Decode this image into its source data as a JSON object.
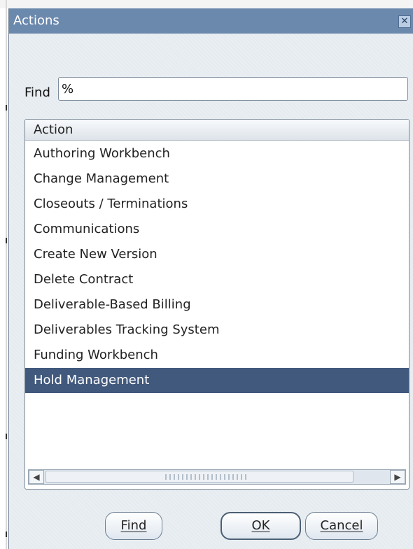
{
  "window": {
    "title": "Actions",
    "close_glyph": "✕"
  },
  "find": {
    "label": "Find",
    "value": "%"
  },
  "list": {
    "column_header": "Action",
    "rows": [
      "Authoring Workbench",
      "Change Management",
      "Closeouts / Terminations",
      "Communications",
      "Create New Version",
      "Delete Contract",
      "Deliverable-Based Billing",
      "Deliverables Tracking System",
      "Funding Workbench",
      "Hold Management"
    ],
    "selected_index": 9
  },
  "scrollbar": {
    "left_arrow": "◀",
    "right_arrow": "▶"
  },
  "buttons": {
    "find_label": "Find",
    "ok_label": "OK",
    "cancel_label": "Cancel"
  },
  "colors": {
    "titlebar": "#6b88ad",
    "selection": "#41597d",
    "dialog_bg": "#e9eef2"
  }
}
